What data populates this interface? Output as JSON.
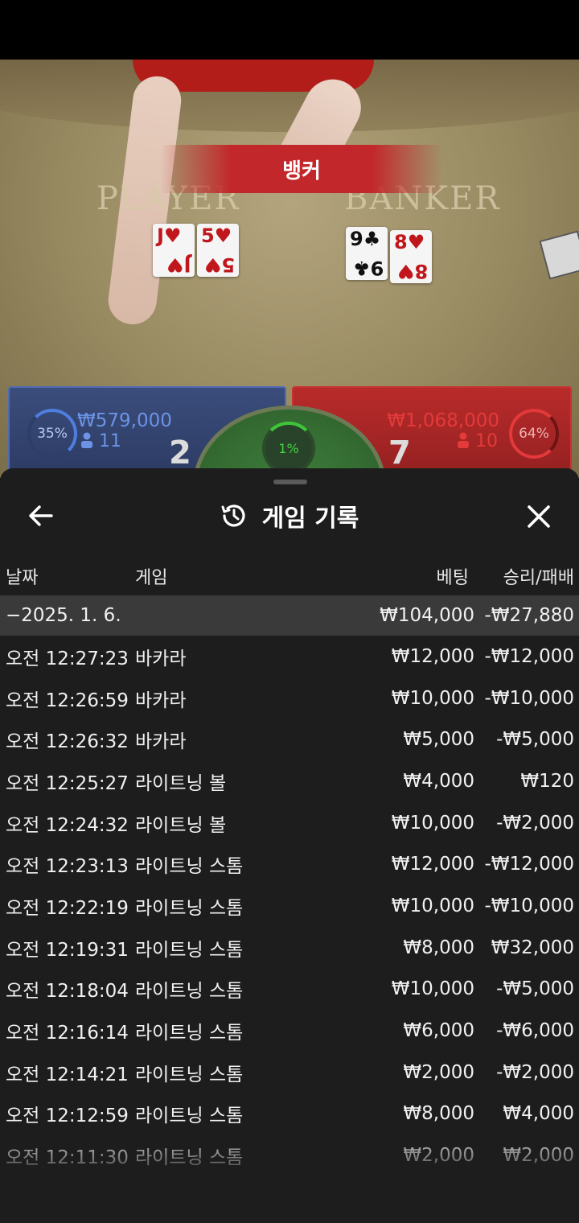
{
  "game": {
    "result_banner": "뱅커",
    "player_label": "PLAYER",
    "banker_label": "BANKER",
    "player_cards": [
      {
        "rank": "J",
        "suit": "♥",
        "color": "red"
      },
      {
        "rank": "5",
        "suit": "♥",
        "color": "red"
      }
    ],
    "banker_cards": [
      {
        "rank": "9",
        "suit": "♣",
        "color": "black"
      },
      {
        "rank": "8",
        "suit": "♥",
        "color": "red"
      }
    ],
    "player": {
      "percent": "35%",
      "amount": "₩579,000",
      "count": "11",
      "score": "2"
    },
    "banker": {
      "percent": "64%",
      "amount": "₩1,068,000",
      "count": "10",
      "score": "7"
    },
    "tie": {
      "percent": "1%"
    }
  },
  "history": {
    "title": "게임 기록",
    "back_icon": "arrow-left-icon",
    "title_icon": "history-clock-icon",
    "close_icon": "close-icon",
    "headers": {
      "date": "날짜",
      "game": "게임",
      "bet": "베팅",
      "win_loss": "승리/패배"
    },
    "date_group": {
      "date": "−2025. 1. 6.",
      "bet": "₩104,000",
      "win_loss": "-₩27,880"
    },
    "rows": [
      {
        "time": "오전 12:27:23",
        "game": "바카라",
        "bet": "₩12,000",
        "win_loss": "-₩12,000"
      },
      {
        "time": "오전 12:26:59",
        "game": "바카라",
        "bet": "₩10,000",
        "win_loss": "-₩10,000"
      },
      {
        "time": "오전 12:26:32",
        "game": "바카라",
        "bet": "₩5,000",
        "win_loss": "-₩5,000"
      },
      {
        "time": "오전 12:25:27",
        "game": "라이트닝 볼",
        "bet": "₩4,000",
        "win_loss": "₩120"
      },
      {
        "time": "오전 12:24:32",
        "game": "라이트닝 볼",
        "bet": "₩10,000",
        "win_loss": "-₩2,000"
      },
      {
        "time": "오전 12:23:13",
        "game": "라이트닝 스톰",
        "bet": "₩12,000",
        "win_loss": "-₩12,000"
      },
      {
        "time": "오전 12:22:19",
        "game": "라이트닝 스톰",
        "bet": "₩10,000",
        "win_loss": "-₩10,000"
      },
      {
        "time": "오전 12:19:31",
        "game": "라이트닝 스톰",
        "bet": "₩8,000",
        "win_loss": "₩32,000"
      },
      {
        "time": "오전 12:18:04",
        "game": "라이트닝 스톰",
        "bet": "₩10,000",
        "win_loss": "-₩5,000"
      },
      {
        "time": "오전 12:16:14",
        "game": "라이트닝 스톰",
        "bet": "₩6,000",
        "win_loss": "-₩6,000"
      },
      {
        "time": "오전 12:14:21",
        "game": "라이트닝 스톰",
        "bet": "₩2,000",
        "win_loss": "-₩2,000"
      },
      {
        "time": "오전 12:12:59",
        "game": "라이트닝 스톰",
        "bet": "₩8,000",
        "win_loss": "₩4,000"
      },
      {
        "time": "오전 12:11:30",
        "game": "라이트닝 스톰",
        "bet": "₩2,000",
        "win_loss": "₩2,000"
      }
    ]
  }
}
